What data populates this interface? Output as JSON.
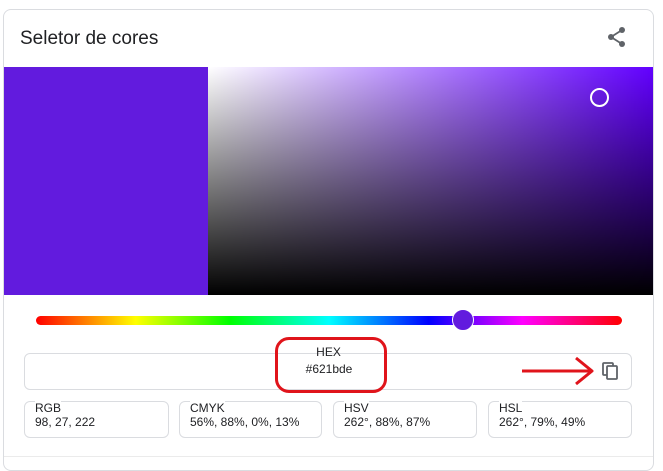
{
  "card": {
    "title": "Seletor de cores"
  },
  "icons": {
    "share": "share-icon",
    "copy": "copy-icon"
  },
  "color": {
    "hex": "#621bde",
    "hue_color": "#6200ff",
    "saturation": 0.88,
    "value": 0.87,
    "hue_fraction": 0.728
  },
  "fields": {
    "hex": {
      "label": "HEX",
      "value": "#621bde"
    },
    "rgb": {
      "label": "RGB",
      "value": "98, 27, 222"
    },
    "cmyk": {
      "label": "CMYK",
      "value": "56%, 88%, 0%, 13%"
    },
    "hsv": {
      "label": "HSV",
      "value": "262°, 88%, 87%"
    },
    "hsl": {
      "label": "HSL",
      "value": "262°, 79%, 49%"
    }
  },
  "annotation_color": "#e0141b"
}
